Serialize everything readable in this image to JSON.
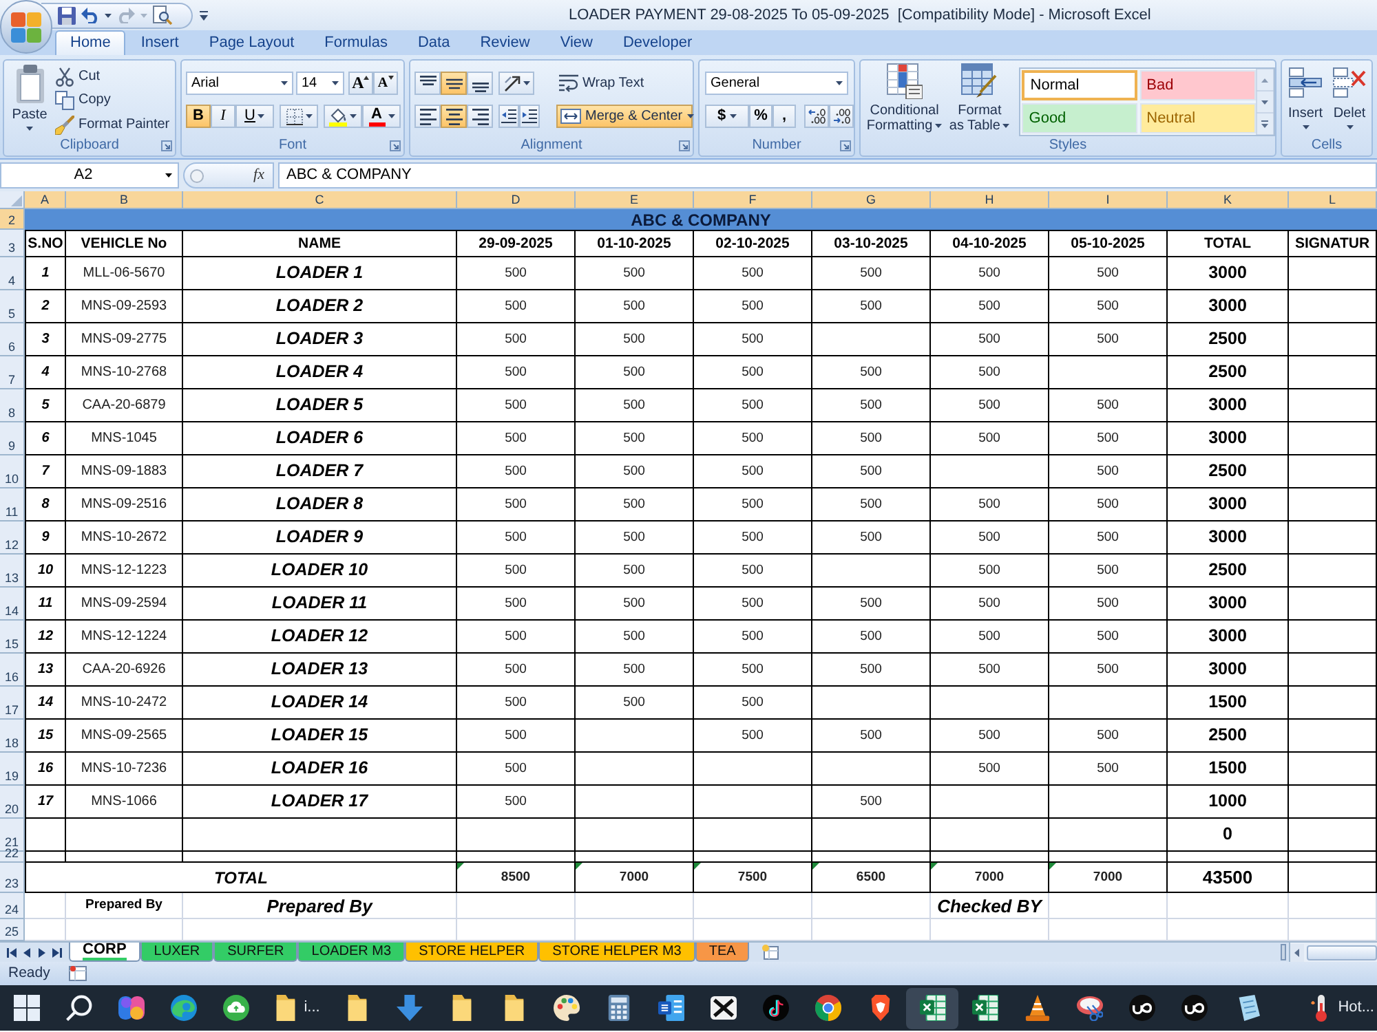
{
  "title_bar": {
    "title": "LOADER PAYMENT 29-08-2025 To 05-09-2025  [Compatibility Mode] - Microsoft Excel"
  },
  "ribbon_tabs": [
    {
      "label": "Home",
      "selected": true
    },
    {
      "label": "Insert",
      "selected": false
    },
    {
      "label": "Page Layout",
      "selected": false
    },
    {
      "label": "Formulas",
      "selected": false
    },
    {
      "label": "Data",
      "selected": false
    },
    {
      "label": "Review",
      "selected": false
    },
    {
      "label": "View",
      "selected": false
    },
    {
      "label": "Developer",
      "selected": false
    }
  ],
  "clipboard": {
    "label": "Clipboard",
    "paste": "Paste",
    "commands": [
      {
        "kind": "cut",
        "label": "Cut"
      },
      {
        "kind": "copy",
        "label": "Copy"
      },
      {
        "kind": "painter",
        "label": "Format Painter"
      }
    ]
  },
  "font": {
    "label": "Font",
    "name": "Arial",
    "size": "14",
    "grow": "A",
    "shrink": "A",
    "styles": [
      {
        "kind": "bold",
        "label": "B",
        "selected": true
      },
      {
        "kind": "italic",
        "label": "I",
        "selected": false
      },
      {
        "kind": "underline",
        "label": "U",
        "selected": false
      }
    ],
    "font_color_label": "A"
  },
  "alignment": {
    "label": "Alignment",
    "vertical": [
      {
        "kind": "top",
        "selected": false
      },
      {
        "kind": "middle",
        "selected": true
      },
      {
        "kind": "bottom",
        "selected": false
      }
    ],
    "horizontal": [
      {
        "kind": "left",
        "selected": false
      },
      {
        "kind": "center",
        "selected": true
      },
      {
        "kind": "right",
        "selected": false
      }
    ],
    "wrap_text": "Wrap Text",
    "merge": {
      "label": "Merge & Center",
      "selected": true
    }
  },
  "number": {
    "label": "Number",
    "format": "General",
    "symbols": [
      {
        "kind": "currency",
        "label": "$"
      },
      {
        "kind": "percent",
        "label": "%"
      },
      {
        "kind": "comma",
        "label": ","
      }
    ]
  },
  "styles": {
    "label": "Styles",
    "conditional": [
      "Conditional",
      "Formatting"
    ],
    "table": [
      "Format",
      "as Table"
    ],
    "gallery": [
      {
        "kind": "normal",
        "label": "Normal",
        "selected": true
      },
      {
        "kind": "bad",
        "label": "Bad",
        "selected": false
      },
      {
        "kind": "good",
        "label": "Good",
        "selected": false
      },
      {
        "kind": "neutral",
        "label": "Neutral",
        "selected": false
      }
    ]
  },
  "cells": {
    "label": "Cells",
    "commands": [
      {
        "kind": "insert",
        "label": "Insert"
      },
      {
        "kind": "delete",
        "label": "Delet"
      }
    ]
  },
  "formula_bar": {
    "name_box": "A2",
    "fx": "fx",
    "content": "ABC & COMPANY"
  },
  "sheet": {
    "columns": [
      {
        "label": "A",
        "selected": true
      },
      {
        "label": "B",
        "selected": true
      },
      {
        "label": "C",
        "selected": true
      },
      {
        "label": "D",
        "selected": true
      },
      {
        "label": "E",
        "selected": true
      },
      {
        "label": "F",
        "selected": true
      },
      {
        "label": "G",
        "selected": true
      },
      {
        "label": "H",
        "selected": true
      },
      {
        "label": "I",
        "selected": true
      },
      {
        "label": "K",
        "selected": true
      },
      {
        "label": "L",
        "selected": true
      }
    ],
    "banner": {
      "row": "2",
      "selected": true,
      "text": "ABC & COMPANY"
    },
    "header": {
      "row": "3",
      "selected": false,
      "cells": [
        "S.NO",
        "VEHICLE No",
        "NAME",
        "29-09-2025",
        "01-10-2025",
        "02-10-2025",
        "03-10-2025",
        "04-10-2025",
        "05-10-2025",
        "TOTAL",
        "SIGNATUR"
      ]
    },
    "entries": [
      {
        "row": "4",
        "selected": false,
        "sno": "1",
        "vehicle": "MLL-06-5670",
        "name": "LOADER 1",
        "amounts": {
          "day_1": "500",
          "day_2": "500",
          "day_3": "500",
          "day_4": "500",
          "day_5": "500",
          "day_6": "500"
        },
        "total": "3000"
      },
      {
        "row": "5",
        "selected": false,
        "sno": "2",
        "vehicle": "MNS-09-2593",
        "name": "LOADER 2",
        "amounts": {
          "day_1": "500",
          "day_2": "500",
          "day_3": "500",
          "day_4": "500",
          "day_5": "500",
          "day_6": "500"
        },
        "total": "3000"
      },
      {
        "row": "6",
        "selected": false,
        "sno": "3",
        "vehicle": "MNS-09-2775",
        "name": "LOADER 3",
        "amounts": {
          "day_1": "500",
          "day_2": "500",
          "day_3": "500",
          "day_5": "500",
          "day_6": "500"
        },
        "total": "2500"
      },
      {
        "row": "7",
        "selected": false,
        "sno": "4",
        "vehicle": "MNS-10-2768",
        "name": "LOADER 4",
        "amounts": {
          "day_1": "500",
          "day_2": "500",
          "day_3": "500",
          "day_4": "500",
          "day_5": "500"
        },
        "total": "2500"
      },
      {
        "row": "8",
        "selected": false,
        "sno": "5",
        "vehicle": "CAA-20-6879",
        "name": "LOADER 5",
        "amounts": {
          "day_1": "500",
          "day_2": "500",
          "day_3": "500",
          "day_4": "500",
          "day_5": "500",
          "day_6": "500"
        },
        "total": "3000"
      },
      {
        "row": "9",
        "selected": false,
        "sno": "6",
        "vehicle": "MNS-1045",
        "name": "LOADER 6",
        "amounts": {
          "day_1": "500",
          "day_2": "500",
          "day_3": "500",
          "day_4": "500",
          "day_5": "500",
          "day_6": "500"
        },
        "total": "3000"
      },
      {
        "row": "10",
        "selected": false,
        "sno": "7",
        "vehicle": "MNS-09-1883",
        "name": "LOADER 7",
        "amounts": {
          "day_1": "500",
          "day_2": "500",
          "day_3": "500",
          "day_4": "500",
          "day_6": "500"
        },
        "total": "2500"
      },
      {
        "row": "11",
        "selected": false,
        "sno": "8",
        "vehicle": "MNS-09-2516",
        "name": "LOADER 8",
        "amounts": {
          "day_1": "500",
          "day_2": "500",
          "day_3": "500",
          "day_4": "500",
          "day_5": "500",
          "day_6": "500"
        },
        "total": "3000"
      },
      {
        "row": "12",
        "selected": false,
        "sno": "9",
        "vehicle": "MNS-10-2672",
        "name": "LOADER 9",
        "amounts": {
          "day_1": "500",
          "day_2": "500",
          "day_3": "500",
          "day_4": "500",
          "day_5": "500",
          "day_6": "500"
        },
        "total": "3000"
      },
      {
        "row": "13",
        "selected": false,
        "sno": "10",
        "vehicle": "MNS-12-1223",
        "name": "LOADER 10",
        "amounts": {
          "day_1": "500",
          "day_2": "500",
          "day_3": "500",
          "day_5": "500",
          "day_6": "500"
        },
        "total": "2500"
      },
      {
        "row": "14",
        "selected": false,
        "sno": "11",
        "vehicle": "MNS-09-2594",
        "name": "LOADER 11",
        "amounts": {
          "day_1": "500",
          "day_2": "500",
          "day_3": "500",
          "day_4": "500",
          "day_5": "500",
          "day_6": "500"
        },
        "total": "3000"
      },
      {
        "row": "15",
        "selected": false,
        "sno": "12",
        "vehicle": "MNS-12-1224",
        "name": "LOADER 12",
        "amounts": {
          "day_1": "500",
          "day_2": "500",
          "day_3": "500",
          "day_4": "500",
          "day_5": "500",
          "day_6": "500"
        },
        "total": "3000"
      },
      {
        "row": "16",
        "selected": false,
        "sno": "13",
        "vehicle": "CAA-20-6926",
        "name": "LOADER 13",
        "amounts": {
          "day_1": "500",
          "day_2": "500",
          "day_3": "500",
          "day_4": "500",
          "day_5": "500",
          "day_6": "500"
        },
        "total": "3000"
      },
      {
        "row": "17",
        "selected": false,
        "sno": "14",
        "vehicle": "MNS-10-2472",
        "name": "LOADER 14",
        "amounts": {
          "day_1": "500",
          "day_2": "500",
          "day_3": "500"
        },
        "total": "1500"
      },
      {
        "row": "18",
        "selected": false,
        "sno": "15",
        "vehicle": "MNS-09-2565",
        "name": "LOADER 15",
        "amounts": {
          "day_1": "500",
          "day_3": "500",
          "day_4": "500",
          "day_5": "500",
          "day_6": "500"
        },
        "total": "2500"
      },
      {
        "row": "19",
        "selected": false,
        "sno": "16",
        "vehicle": "MNS-10-7236",
        "name": "LOADER 16",
        "amounts": {
          "day_1": "500",
          "day_5": "500",
          "day_6": "500"
        },
        "total": "1500"
      },
      {
        "row": "20",
        "selected": false,
        "sno": "17",
        "vehicle": "MNS-1066",
        "name": "LOADER 17",
        "amounts": {
          "day_1": "500",
          "day_4": "500"
        },
        "total": "1000"
      },
      {
        "row": "21",
        "selected": false,
        "total": "0"
      }
    ],
    "gap_row": {
      "row": "22",
      "selected": false
    },
    "total_row": {
      "row": "23",
      "selected": false,
      "label": "TOTAL",
      "amounts": [
        {
          "value": "8500",
          "flagged": true
        },
        {
          "value": "7000",
          "flagged": true
        },
        {
          "value": "7500",
          "flagged": true
        },
        {
          "value": "6500",
          "flagged": true
        },
        {
          "value": "7000",
          "flagged": true
        },
        {
          "value": "7000",
          "flagged": true
        }
      ],
      "total": "43500"
    },
    "sign_row": {
      "row": "24",
      "selected": false,
      "left": "Prepared By",
      "middle": "Prepared By",
      "right": "Checked BY"
    },
    "blank_row": {
      "row": "25",
      "selected": false
    }
  },
  "sheet_tabs": [
    {
      "label": "CORP",
      "selected": true,
      "color": "#33cc66"
    },
    {
      "label": "LUXER",
      "selected": false,
      "color": "#33cc66"
    },
    {
      "label": "SURFER",
      "selected": false,
      "color": "#33cc66"
    },
    {
      "label": "LOADER M3",
      "selected": false,
      "color": "#33cc66"
    },
    {
      "label": "STORE HELPER",
      "selected": false,
      "color": "#ffc000"
    },
    {
      "label": "STORE HELPER M3",
      "selected": false,
      "color": "#ffc000"
    },
    {
      "label": "TEA",
      "selected": false,
      "color": "#f79646"
    }
  ],
  "status_bar": {
    "status": "Ready"
  },
  "taskbar": {
    "apps": [
      {
        "kind": "start",
        "selected": false
      },
      {
        "kind": "search",
        "selected": false
      },
      {
        "kind": "blob",
        "selected": false
      },
      {
        "kind": "swirl",
        "selected": false
      },
      {
        "kind": "cloud",
        "selected": false
      },
      {
        "kind": "folder",
        "label": "i...",
        "selected": false
      },
      {
        "kind": "folder",
        "selected": false
      },
      {
        "kind": "download",
        "selected": false
      },
      {
        "kind": "folder",
        "selected": false
      },
      {
        "kind": "folder",
        "selected": false
      },
      {
        "kind": "palette",
        "selected": false
      },
      {
        "kind": "calculator",
        "selected": false
      },
      {
        "kind": "document",
        "selected": false
      },
      {
        "kind": "cross",
        "selected": false
      },
      {
        "kind": "note",
        "selected": false
      },
      {
        "kind": "segmented",
        "selected": false
      },
      {
        "kind": "shield",
        "selected": false
      },
      {
        "kind": "spreadsheet",
        "selected": true
      },
      {
        "kind": "spreadsheet",
        "selected": false
      },
      {
        "kind": "cone",
        "selected": false
      },
      {
        "kind": "snip",
        "selected": false
      },
      {
        "kind": "wave",
        "selected": false
      },
      {
        "kind": "wave",
        "selected": false
      },
      {
        "kind": "notepad",
        "selected": false
      }
    ],
    "weather": "Hot..."
  }
}
